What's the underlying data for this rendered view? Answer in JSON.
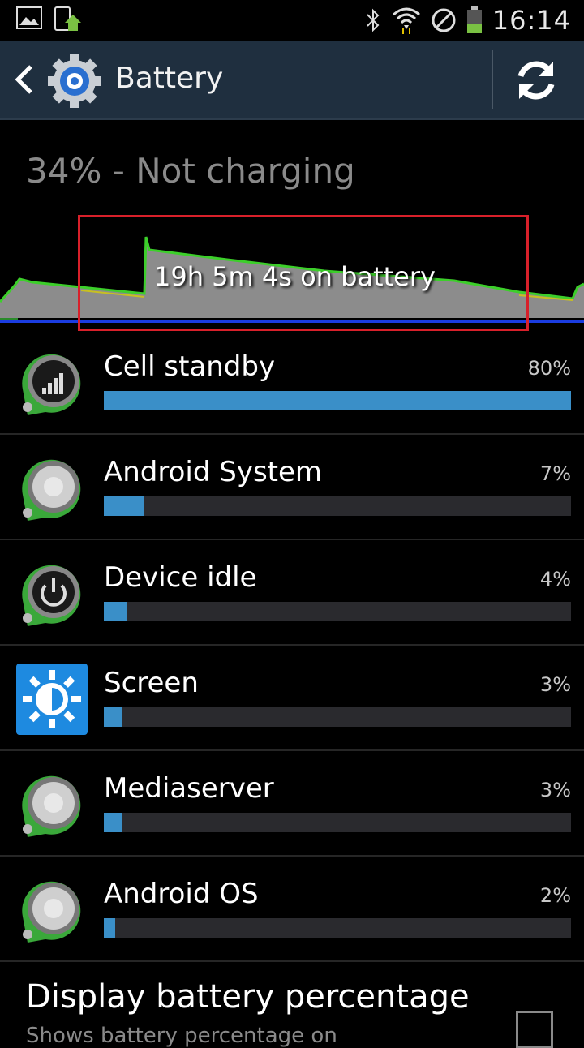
{
  "status_bar": {
    "time": "16:14",
    "left_icons": [
      "image-icon",
      "phone-update-icon"
    ],
    "right_icons": [
      "bluetooth-icon",
      "wifi-icon",
      "no-signal-icon",
      "battery-icon"
    ]
  },
  "action_bar": {
    "title": "Battery"
  },
  "charge_status": "34% - Not charging",
  "graph": {
    "label": "19h 5m 4s on battery"
  },
  "usage": [
    {
      "name": "Cell standby",
      "percent_label": "80%",
      "percent": 80,
      "icon": "signal-icon"
    },
    {
      "name": "Android System",
      "percent_label": "7%",
      "percent": 7,
      "icon": "android-system-icon"
    },
    {
      "name": "Device idle",
      "percent_label": "4%",
      "percent": 4,
      "icon": "power-icon"
    },
    {
      "name": "Screen",
      "percent_label": "3%",
      "percent": 3,
      "icon": "brightness-icon"
    },
    {
      "name": "Mediaserver",
      "percent_label": "3%",
      "percent": 3,
      "icon": "mediaserver-icon"
    },
    {
      "name": "Android OS",
      "percent_label": "2%",
      "percent": 2,
      "icon": "android-os-icon"
    }
  ],
  "settings": {
    "display_percentage_title": "Display battery percentage",
    "display_percentage_subtitle": "Shows battery percentage on"
  },
  "colors": {
    "action_bar": "#1f2f3f",
    "usage_bar": "#3a8fc8",
    "graph_line": "#3ccf2a",
    "highlight": "#d8202a"
  }
}
